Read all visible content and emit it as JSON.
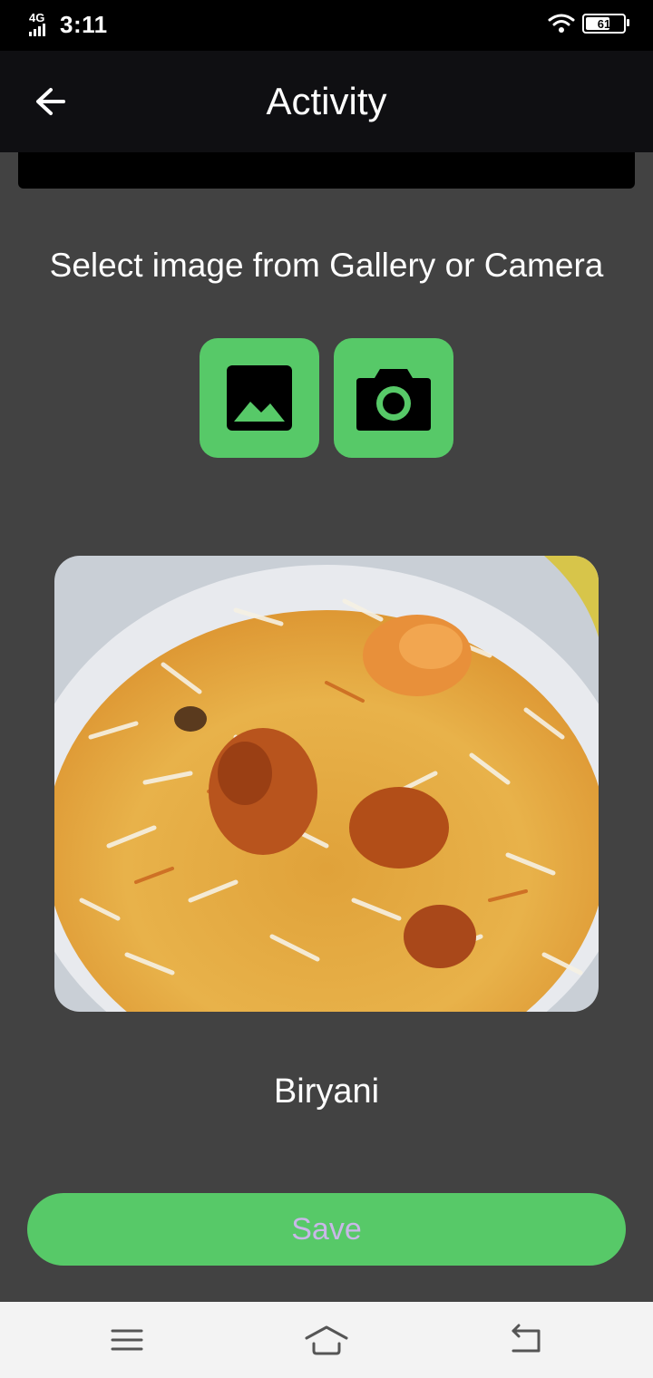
{
  "status_bar": {
    "network": "4G",
    "time": "3:11",
    "battery": "61",
    "icons": [
      "signal-icon",
      "wifi-icon",
      "battery-icon"
    ]
  },
  "app_bar": {
    "title": "Activity",
    "back_icon": "arrow-left-icon"
  },
  "main": {
    "prompt": "Select image from Gallery or Camera",
    "gallery_icon": "image-icon",
    "camera_icon": "camera-icon",
    "food_label": "Biryani",
    "save_label": "Save"
  },
  "nav_bar": {
    "icons": [
      "menu-icon",
      "home-icon",
      "back-icon"
    ]
  },
  "colors": {
    "background": "#424242",
    "accent": "#57c968",
    "app_bar": "#0f0f12",
    "save_text": "#c9b7e8"
  }
}
